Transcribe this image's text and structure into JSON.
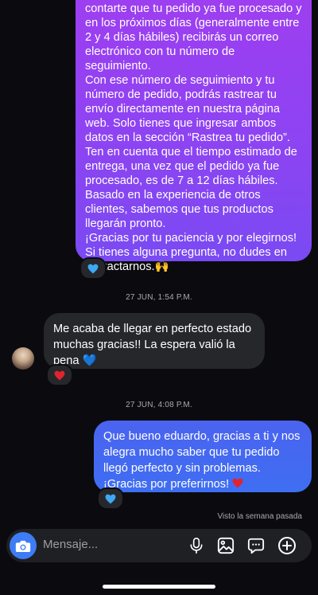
{
  "conversation": {
    "sent_top_paragraphs": [
      "contarte que tu pedido ya fue procesado y en los próximos días (generalmente entre 2 y 4 días hábiles) recibirás un correo electrónico con tu número de seguimiento.",
      "Con ese número de seguimiento y tu número de pedido, podrás rastrear tu envío directamente en nuestra página web. Solo tienes que ingresar ambos datos en la sección “Rastrea tu pedido”.",
      "Ten en cuenta que el tiempo estimado de entrega, una vez que el pedido ya fue procesado, es de 7 a 12 días hábiles. Basado en la experiencia de otros clientes, sabemos que tus productos llegarán pronto.",
      "¡Gracias por tu paciencia y por elegirnos! Si tienes alguna pregunta, no dudes en contactarnos.🙌"
    ],
    "timestamp_1": "27 JUN, 1:54 P.M.",
    "received_text": "Me acaba de llegar en perfecto estado muchas gracias!! La espera valió la pena 💙",
    "timestamp_2": "27 JUN, 4:08 P.M.",
    "sent_bottom_line1": "Que bueno eduardo, gracias a ti y nos alegra mucho saber que tu pedido llegó perfecto y sin problemas.",
    "sent_bottom_line2": "¡Gracias por preferirnos!",
    "seen_status": "Visto la semana pasada"
  },
  "reactions": {
    "sent_top": "blue-heart",
    "received": "red-heart",
    "sent_bottom": "blue-heart"
  },
  "composer": {
    "placeholder": "Mensaje..."
  },
  "colors": {
    "background": "#0b0b0f",
    "sent_gradient_top": "#9f3ef0",
    "sent_bubble_blue": "#4b63f0",
    "received_bubble": "#26272b",
    "accent_blue": "#3d7cf4",
    "red_heart": "#e0242f",
    "blue_heart": "#3ea8f5"
  }
}
